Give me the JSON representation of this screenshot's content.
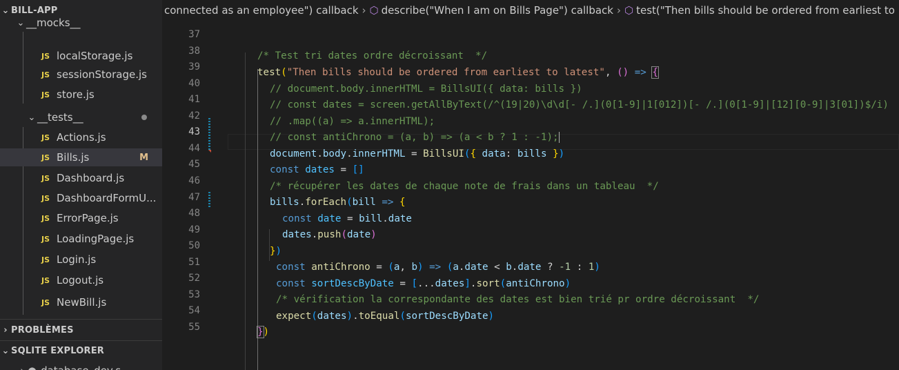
{
  "explorer": {
    "project_title": "BILL-APP",
    "folders": {
      "mocks": "__mocks__",
      "tests": "__tests__"
    },
    "mock_files": [
      "localStorage.js",
      "sessionStorage.js",
      "store.js"
    ],
    "test_files": [
      {
        "name": "Actions.js",
        "badge": ""
      },
      {
        "name": "Bills.js",
        "badge": "M"
      },
      {
        "name": "Dashboard.js",
        "badge": ""
      },
      {
        "name": "DashboardFormU...",
        "badge": ""
      },
      {
        "name": "ErrorPage.js",
        "badge": ""
      },
      {
        "name": "LoadingPage.js",
        "badge": ""
      },
      {
        "name": "Login.js",
        "badge": ""
      },
      {
        "name": "Logout.js",
        "badge": ""
      },
      {
        "name": "NewBill.js",
        "badge": ""
      }
    ],
    "file_icon_label": "JS",
    "sections": [
      "PROBLÈMES",
      "SQLITE EXPLORER"
    ],
    "db_item": "database_dev.s"
  },
  "breadcrumb": [
    "connected as an employee\") callback",
    "describe(\"When I am on Bills Page\") callback",
    "test(\"Then bills should be ordered from earliest to latest\") callback"
  ],
  "editor": {
    "line_numbers": [
      37,
      38,
      39,
      40,
      41,
      42,
      43,
      44,
      45,
      46,
      47,
      48,
      49,
      50,
      51,
      52,
      53,
      54,
      55
    ],
    "active_line": 43,
    "colors": {
      "background": "#1e1e1e",
      "comment": "#6a9955",
      "keyword": "#569cd6",
      "string": "#ce9178"
    }
  }
}
